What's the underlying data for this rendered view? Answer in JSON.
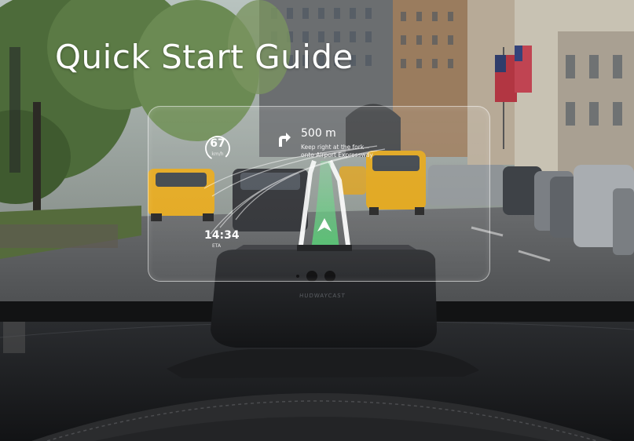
{
  "title": "Quick Start Guide",
  "hud": {
    "speed": {
      "value": "67",
      "unit": "km/h"
    },
    "navigation": {
      "distance": "500 m",
      "instruction_line1": "Keep right at the fork",
      "instruction_line2": "onto Airport Expressway"
    },
    "clock": {
      "time": "14:34",
      "label": "ETA"
    }
  },
  "device": {
    "brand": "HUDWAYCAST"
  },
  "icons": {
    "turn": "turn-right-arrow-icon",
    "position": "position-marker-icon"
  },
  "colors": {
    "route_green": "#4fc36d",
    "hud_text": "#ffffff",
    "taxi_yellow": "#e4a71a",
    "device_body": "#202225"
  }
}
